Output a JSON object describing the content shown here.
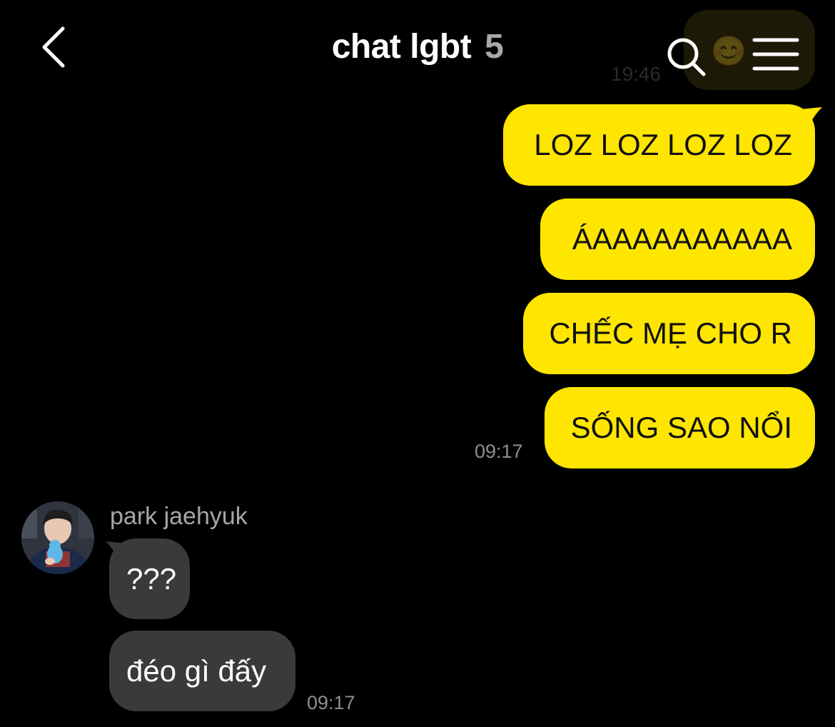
{
  "header": {
    "title": "chat lgbt",
    "member_count": "5"
  },
  "ghost": {
    "emoji": "😊",
    "time": "19:46"
  },
  "messages": {
    "outgoing": [
      "LOZ LOZ LOZ LOZ",
      "ÁAAAAAAAAAA",
      "CHẾC MẸ CHO R",
      "SỐNG SAO NỔI"
    ],
    "outgoing_time": "09:17",
    "sender_name": "park jaehyuk",
    "incoming": [
      "???",
      "đéo gì đấy"
    ],
    "incoming_time": "09:17"
  },
  "colors": {
    "background": "#000000",
    "outgoing_bubble": "#ffe600",
    "incoming_bubble": "#3a3a3c",
    "timestamp": "#8e8e8e"
  },
  "icons": {
    "back": "chevron-left-icon",
    "search": "search-icon",
    "menu": "hamburger-menu-icon"
  }
}
